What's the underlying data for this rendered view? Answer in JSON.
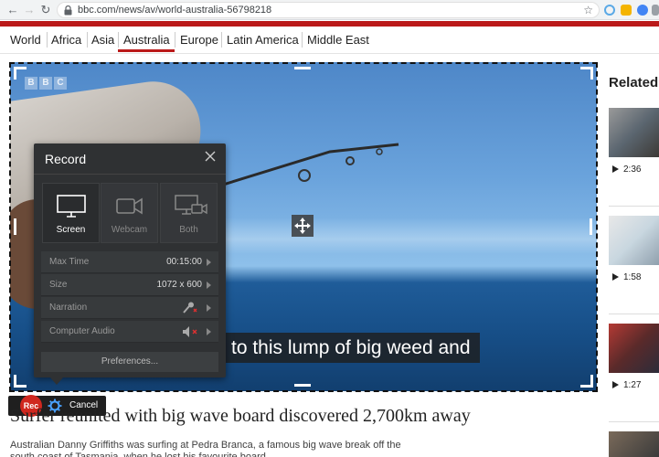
{
  "browser": {
    "url": "bbc.com/news/av/world-australia-56798218"
  },
  "site": {
    "nav_items": [
      "World",
      "Africa",
      "Asia",
      "Australia",
      "Europe",
      "Latin America",
      "Middle East"
    ],
    "active_nav": "Australia"
  },
  "video": {
    "logo_letters": [
      "B",
      "B",
      "C"
    ],
    "subtitle": "to this lump of big weed and"
  },
  "recorder": {
    "title": "Record",
    "modes": [
      {
        "label": "Screen",
        "icon": "monitor-icon",
        "active": true
      },
      {
        "label": "Webcam",
        "icon": "webcam-icon",
        "active": false
      },
      {
        "label": "Both",
        "icon": "screen-and-webcam-icon",
        "active": false
      }
    ],
    "options": {
      "max_time_label": "Max Time",
      "max_time_value": "00:15:00",
      "size_label": "Size",
      "size_value": "1072 x 600",
      "narration_label": "Narration",
      "narration_icon": "microphone-muted-icon",
      "audio_label": "Computer Audio",
      "audio_icon": "speaker-muted-icon"
    },
    "preferences_label": "Preferences...",
    "rec_label": "Rec",
    "cancel_label": "Cancel"
  },
  "article": {
    "headline": "Surfer reunited with big wave board discovered 2,700km away",
    "body": "Australian Danny Griffiths was surfing at Pedra Branca, a famous big wave break off the south coast of Tasmania, when he lost his favourite board."
  },
  "related": {
    "title": "Related",
    "items": [
      {
        "duration": "2:36"
      },
      {
        "duration": "1:58"
      },
      {
        "duration": "1:27"
      }
    ]
  },
  "colors": {
    "bbc_red": "#bb1919",
    "rec_red": "#d0281f",
    "panel_bg": "#2f3133"
  }
}
